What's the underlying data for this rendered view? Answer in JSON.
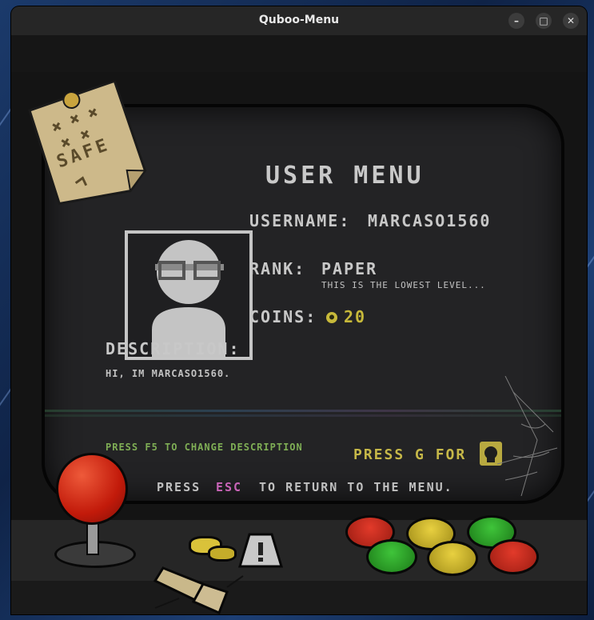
{
  "window": {
    "title": "Quboo-Menu",
    "controls": {
      "minimize": "–",
      "maximize": "□",
      "close": "✕"
    }
  },
  "menu": {
    "title": "USER MENU",
    "username_label": "USERNAME:",
    "username_value": "MARCASO1560",
    "rank_label": "RANK:",
    "rank_value": "PAPER",
    "rank_note": "THIS IS THE LOWEST LEVEL...",
    "coins_label": "COINS:",
    "coins_value": "20",
    "description_label": "DESCRIPTION:",
    "description_value": "HI, IM MARCASO1560."
  },
  "footer": {
    "f5_hint": "PRESS F5 TO CHANGE DESCRIPTION",
    "g_hint": "PRESS G FOR",
    "press": "PRESS",
    "esc_key": "ESC",
    "esc_hint": "TO RETURN TO THE MENU."
  },
  "note": {
    "text": "SAFE"
  },
  "icons": {
    "coin": "coin-icon",
    "github": "github-icon",
    "avatar": "user-avatar-icon"
  },
  "colors": {
    "accent_yellow": "#c6b848",
    "hint_green": "#7fae55",
    "esc_pink": "#c864b7",
    "text_grey": "#c8c8c8"
  }
}
